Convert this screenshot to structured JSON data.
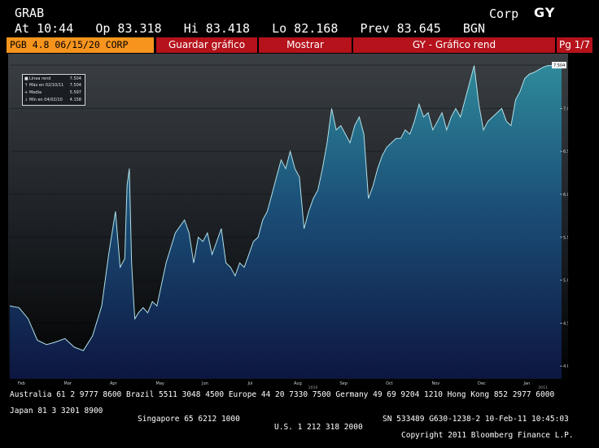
{
  "header": {
    "ticker": "GRAB",
    "quote_line": "At 10:44   Op 83.318   Hi 83.418   Lo 82.168   Prev 83.645   BGN",
    "corp": "Corp",
    "gy": "GY"
  },
  "tabs": {
    "security": "PGB 4.8 06/15/20 CORP",
    "save_chart": "Guardar gráfico",
    "show": "Mostrar",
    "chart_title": "GY - Gráfico rend",
    "page": "Pg 1/7"
  },
  "legend": {
    "items": [
      {
        "label": "Línea rend",
        "value": "7.504",
        "icon": "square-icon"
      },
      {
        "label": "Máx en 02/10/11",
        "value": "7.504",
        "icon": "up-arrow-icon"
      },
      {
        "label": "Media",
        "value": "5.597",
        "icon": "plus-icon"
      },
      {
        "label": "Mín en 04/02/10",
        "value": "4.158",
        "icon": "down-arrow-icon"
      }
    ]
  },
  "footer": {
    "line1": "Australia 61 2 9777 8600 Brazil 5511 3048 4500 Europe 44 20 7330 7500 Germany 49 69 9204 1210 Hong Kong 852 2977 6000",
    "line2a": "Japan 81 3 3201 8900",
    "line2b": "Singapore 65 6212 1000",
    "line2c": "U.S. 1 212 318 2000",
    "line2d": "Copyright 2011 Bloomberg Finance L.P.",
    "line3": "SN 533489 G630-1238-2 10-Feb-11 10:45:03"
  },
  "colors": {
    "accent_orange": "#f7941d",
    "tab_red": "#b5121b",
    "area_top": "#2f8a9a",
    "area_bottom": "#0d1640",
    "line": "#b0e0e8"
  },
  "chart_data": {
    "type": "area",
    "y_ticks": [
      "4.000",
      "4.500",
      "5.000",
      "5.500",
      "6.000",
      "6.500",
      "7.000",
      "7.504"
    ],
    "ylim": [
      3.85,
      7.6
    ],
    "x_labels": [
      "Feb",
      "Mar",
      "Apr",
      "May",
      "Jun",
      "Jul",
      "Aug",
      "Sep",
      "Oct",
      "Nov",
      "Dec",
      "Jan",
      "Feb"
    ],
    "year_labels": [
      "2010",
      "2011"
    ],
    "current_value_label": "7.504",
    "series": [
      {
        "x": [
          0,
          0.2,
          0.4,
          0.6,
          0.8,
          1.0,
          1.2,
          1.4,
          1.6,
          1.8,
          2.0,
          2.15,
          2.3,
          2.4,
          2.5,
          2.55,
          2.6,
          2.65,
          2.7,
          2.72,
          2.8,
          2.9,
          3.0,
          3.1,
          3.2,
          3.4,
          3.6,
          3.8,
          3.9,
          4.0,
          4.1,
          4.2,
          4.3,
          4.4,
          4.5,
          4.6,
          4.7,
          4.8,
          4.9,
          5.0,
          5.1,
          5.2,
          5.3,
          5.4,
          5.5,
          5.6,
          5.7,
          5.8,
          5.9,
          6.0,
          6.1,
          6.2,
          6.3,
          6.4,
          6.5,
          6.6,
          6.7,
          6.8,
          6.9,
          7.0,
          7.1,
          7.2,
          7.3,
          7.4,
          7.5,
          7.6,
          7.7,
          7.8,
          7.9,
          8.0,
          8.1,
          8.2,
          8.3,
          8.4,
          8.5,
          8.6,
          8.7,
          8.8,
          8.9,
          9.0,
          9.1,
          9.2,
          9.3,
          9.4,
          9.5,
          9.6,
          9.7,
          9.8,
          9.9,
          10.0,
          10.1,
          10.2,
          10.3,
          10.4,
          10.5,
          10.6,
          10.7,
          10.8,
          10.9,
          11.0,
          11.1,
          11.2,
          11.3,
          11.4,
          11.5,
          11.6,
          11.7,
          11.8,
          11.9,
          12.0
        ],
        "y": [
          4.7,
          4.68,
          4.55,
          4.3,
          4.25,
          4.28,
          4.32,
          4.22,
          4.18,
          4.35,
          4.7,
          5.3,
          5.8,
          5.15,
          5.25,
          6.1,
          6.3,
          5.2,
          4.7,
          4.55,
          4.62,
          4.68,
          4.62,
          4.75,
          4.7,
          5.2,
          5.55,
          5.7,
          5.55,
          5.2,
          5.5,
          5.45,
          5.55,
          5.3,
          5.45,
          5.6,
          5.2,
          5.15,
          5.05,
          5.2,
          5.15,
          5.3,
          5.45,
          5.5,
          5.7,
          5.8,
          6.0,
          6.2,
          6.4,
          6.3,
          6.5,
          6.3,
          6.2,
          5.6,
          5.8,
          5.95,
          6.05,
          6.3,
          6.6,
          7.0,
          6.75,
          6.8,
          6.7,
          6.6,
          6.8,
          6.9,
          6.7,
          5.95,
          6.1,
          6.3,
          6.45,
          6.55,
          6.6,
          6.65,
          6.65,
          6.75,
          6.7,
          6.85,
          7.05,
          6.9,
          6.95,
          6.75,
          6.85,
          6.95,
          6.75,
          6.9,
          7.0,
          6.9,
          7.1,
          7.3,
          7.5,
          7.05,
          6.75,
          6.85,
          6.9,
          6.95,
          7.0,
          6.85,
          6.8,
          7.1,
          7.2,
          7.35,
          7.4,
          7.42,
          7.45,
          7.48,
          7.5,
          7.5,
          7.52,
          7.504
        ]
      }
    ]
  }
}
